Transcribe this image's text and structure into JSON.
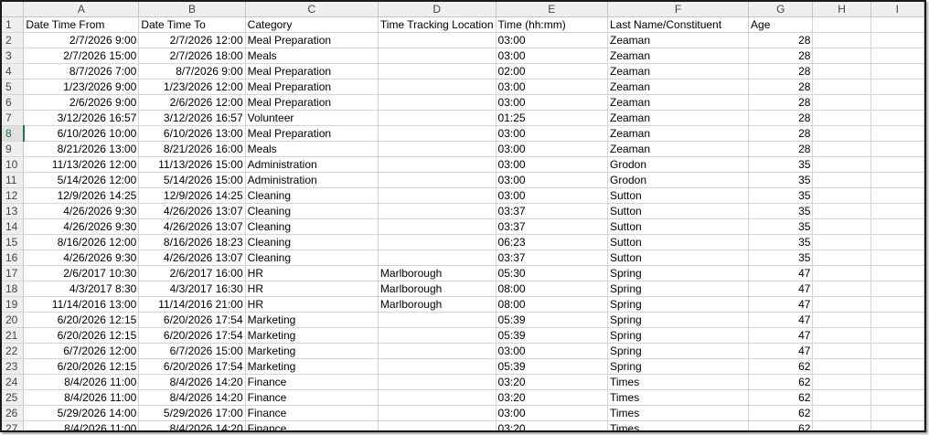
{
  "columns": [
    "A",
    "B",
    "C",
    "D",
    "E",
    "F",
    "G",
    "H",
    "I"
  ],
  "header_row": [
    "Date Time From",
    "Date Time To",
    "Category",
    "Time Tracking Location",
    "Time (hh:mm)",
    "Last Name/Constituent",
    "Age",
    "",
    ""
  ],
  "rows": [
    [
      "2/7/2026 9:00",
      "2/7/2026 12:00",
      "Meal Preparation",
      "",
      "03:00",
      "Zeaman",
      "28"
    ],
    [
      "2/7/2026 15:00",
      "2/7/2026 18:00",
      "Meals",
      "",
      "03:00",
      "Zeaman",
      "28"
    ],
    [
      "8/7/2026 7:00",
      "8/7/2026 9:00",
      "Meal Preparation",
      "",
      "02:00",
      "Zeaman",
      "28"
    ],
    [
      "1/23/2026 9:00",
      "1/23/2026 12:00",
      "Meal Preparation",
      "",
      "03:00",
      "Zeaman",
      "28"
    ],
    [
      "2/6/2026 9:00",
      "2/6/2026 12:00",
      "Meal Preparation",
      "",
      "03:00",
      "Zeaman",
      "28"
    ],
    [
      "3/12/2026 16:57",
      "3/12/2026 16:57",
      "Volunteer",
      "",
      "01:25",
      "Zeaman",
      "28"
    ],
    [
      "6/10/2026 10:00",
      "6/10/2026 13:00",
      "Meal Preparation",
      "",
      "03:00",
      "Zeaman",
      "28"
    ],
    [
      "8/21/2026 13:00",
      "8/21/2026 16:00",
      "Meals",
      "",
      "03:00",
      "Zeaman",
      "28"
    ],
    [
      "11/13/2026 12:00",
      "11/13/2026 15:00",
      "Administration",
      "",
      "03:00",
      "Grodon",
      "35"
    ],
    [
      "5/14/2026 12:00",
      "5/14/2026 15:00",
      "Administration",
      "",
      "03:00",
      "Grodon",
      "35"
    ],
    [
      "12/9/2026 14:25",
      "12/9/2026 14:25",
      "Cleaning",
      "",
      "03:00",
      "Sutton",
      "35"
    ],
    [
      "4/26/2026 9:30",
      "4/26/2026 13:07",
      "Cleaning",
      "",
      "03:37",
      "Sutton",
      "35"
    ],
    [
      "4/26/2026 9:30",
      "4/26/2026 13:07",
      "Cleaning",
      "",
      "03:37",
      "Sutton",
      "35"
    ],
    [
      "8/16/2026 12:00",
      "8/16/2026 18:23",
      "Cleaning",
      "",
      "06:23",
      "Sutton",
      "35"
    ],
    [
      "4/26/2026 9:30",
      "4/26/2026 13:07",
      "Cleaning",
      "",
      "03:37",
      "Sutton",
      "35"
    ],
    [
      "2/6/2017 10:30",
      "2/6/2017 16:00",
      "HR",
      "Marlborough",
      "05:30",
      "Spring",
      "47"
    ],
    [
      "4/3/2017 8:30",
      "4/3/2017 16:30",
      "HR",
      "Marlborough",
      "08:00",
      "Spring",
      "47"
    ],
    [
      "11/14/2016 13:00",
      "11/14/2016 21:00",
      "HR",
      "Marlborough",
      "08:00",
      "Spring",
      "47"
    ],
    [
      "6/20/2026 12:15",
      "6/20/2026 17:54",
      "Marketing",
      "",
      "05:39",
      "Spring",
      "47"
    ],
    [
      "6/20/2026 12:15",
      "6/20/2026 17:54",
      "Marketing",
      "",
      "05:39",
      "Spring",
      "47"
    ],
    [
      "6/7/2026 12:00",
      "6/7/2026 15:00",
      "Marketing",
      "",
      "03:00",
      "Spring",
      "47"
    ],
    [
      "6/20/2026 12:15",
      "6/20/2026 17:54",
      "Marketing",
      "",
      "05:39",
      "Spring",
      "62"
    ],
    [
      "8/4/2026 11:00",
      "8/4/2026 14:20",
      "Finance",
      "",
      "03:20",
      "Times",
      "62"
    ],
    [
      "8/4/2026 11:00",
      "8/4/2026 14:20",
      "Finance",
      "",
      "03:20",
      "Times",
      "62"
    ],
    [
      "5/29/2026 14:00",
      "5/29/2026 17:00",
      "Finance",
      "",
      "03:00",
      "Times",
      "62"
    ],
    [
      "8/4/2026 11:00",
      "8/4/2026 14:20",
      "Finance",
      "",
      "03:20",
      "Times",
      "62"
    ]
  ],
  "active_row": 8,
  "accent_color": "#217346"
}
